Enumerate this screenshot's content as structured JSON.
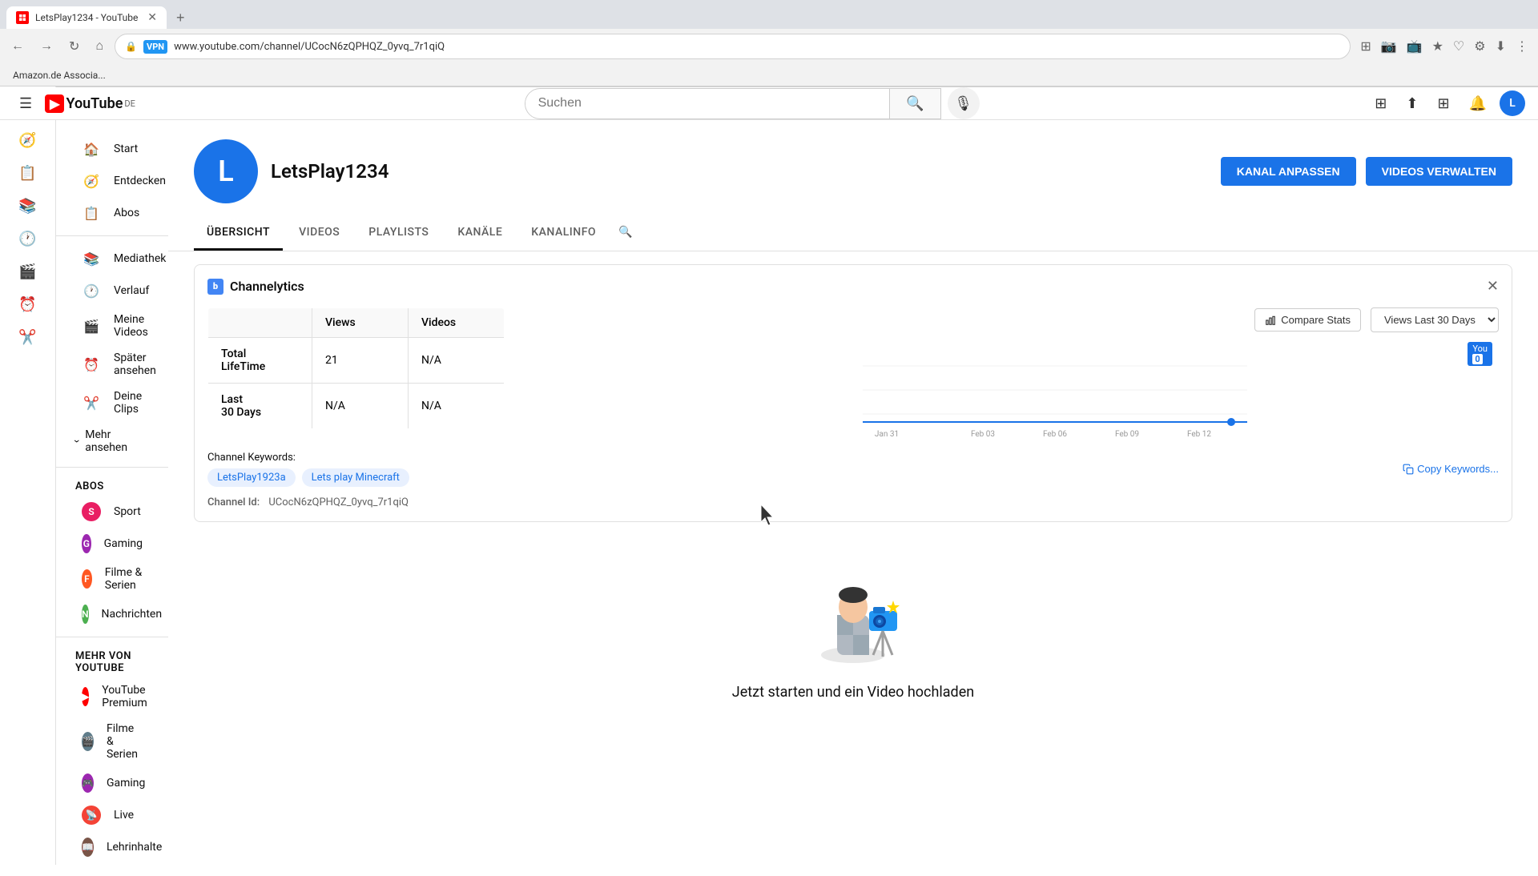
{
  "browser": {
    "tab_title": "LetsPlay1234 - YouTube",
    "url": "www.youtube.com/channel/UCocN6zQPHQZ_0yvq_7r1qiQ",
    "bookmark_label": "Amazon.de Associa..."
  },
  "header": {
    "logo_text": "YouTube",
    "logo_lang": "DE",
    "search_placeholder": "Suchen",
    "search_value": ""
  },
  "sidebar": {
    "items": [
      {
        "label": "Start",
        "icon": "🏠"
      },
      {
        "label": "Entdecken",
        "icon": "🧭"
      },
      {
        "label": "Abos",
        "icon": "📋"
      }
    ],
    "library": [
      {
        "label": "Mediathek",
        "icon": "📚"
      },
      {
        "label": "Verlauf",
        "icon": "🕐"
      },
      {
        "label": "Meine Videos",
        "icon": "🎬"
      },
      {
        "label": "Später ansehen",
        "icon": "⏰"
      },
      {
        "label": "Deine Clips",
        "icon": "✂️"
      }
    ],
    "mehr_ansehen": "Mehr ansehen",
    "abos_title": "ABOS",
    "abos": [
      {
        "label": "Sport",
        "initial": "S",
        "color": "#e91e63"
      },
      {
        "label": "Gaming",
        "initial": "G",
        "color": "#9c27b0"
      },
      {
        "label": "Filme & Serien",
        "initial": "F",
        "color": "#ff5722"
      },
      {
        "label": "Nachrichten",
        "initial": "N",
        "color": "#4caf50"
      }
    ],
    "mehr_von_youtube_title": "MEHR VON YOUTUBE",
    "mehr_von_youtube": [
      {
        "label": "YouTube Premium",
        "icon": "▶"
      },
      {
        "label": "Filme & Serien",
        "icon": "🎬"
      },
      {
        "label": "Gaming",
        "icon": "🎮"
      },
      {
        "label": "Live",
        "icon": "📡"
      },
      {
        "label": "Lehrinhalte",
        "icon": "📖"
      }
    ]
  },
  "channel": {
    "name": "LetsPlay1234",
    "initial": "L",
    "btn_kanal": "KANAL ANPASSEN",
    "btn_videos": "VIDEOS VERWALTEN",
    "tabs": [
      {
        "label": "ÜBERSICHT",
        "active": true
      },
      {
        "label": "VIDEOS",
        "active": false
      },
      {
        "label": "PLAYLISTS",
        "active": false
      },
      {
        "label": "KANÄLE",
        "active": false
      },
      {
        "label": "KANALINFO",
        "active": false
      }
    ]
  },
  "channelytics": {
    "panel_title": "Channelytics",
    "compare_stats_label": "Compare Stats",
    "views_dropdown_label": "Views Last 30 Days",
    "stats": {
      "total_lifetime_label": "Total LifeTime",
      "last_30_days_label": "Last\n30 Days",
      "views_header": "Views",
      "videos_header": "Videos",
      "total_views": "21",
      "total_videos": "N/A",
      "last_views": "N/A",
      "last_videos": "N/A"
    },
    "chart": {
      "you_label": "You",
      "dates": [
        "Jan 31",
        "Feb 03",
        "Feb 06",
        "Feb 09",
        "Feb 12"
      ]
    },
    "keywords_label": "Channel Keywords:",
    "keywords": [
      "LetsPlay1923a",
      "Lets play Minecraft"
    ],
    "copy_keywords_label": "Copy Keywords...",
    "channel_id_label": "Channel Id:",
    "channel_id_value": "UCocN6zQPHQZ_0yvq_7r1qiQ"
  },
  "empty_state": {
    "text": "Jetzt starten und ein Video hochladen"
  }
}
